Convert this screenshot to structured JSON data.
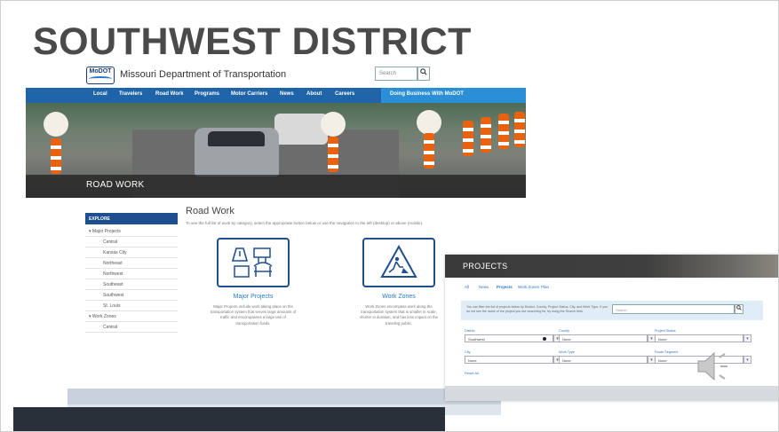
{
  "slide": {
    "title": "SOUTHWEST DISTRICT"
  },
  "modot": {
    "logo_text": "MoDOT",
    "org_name": "Missouri Department of Transportation",
    "search_placeholder": "Search",
    "search_icon": "magnifier-icon",
    "nav": [
      "Local",
      "Travelers",
      "Road Work",
      "Programs",
      "Motor Carriers",
      "News",
      "About",
      "Careers"
    ],
    "nav_cta": "Doing Business With MoDOT",
    "hero_label": "ROAD WORK",
    "sidebar": {
      "header": "EXPLORE",
      "items": [
        {
          "label": "Major Projects",
          "expanded": true
        },
        {
          "label": "Central"
        },
        {
          "label": "Kansas City"
        },
        {
          "label": "Northeast"
        },
        {
          "label": "Northwest"
        },
        {
          "label": "Southeast"
        },
        {
          "label": "Southwest"
        },
        {
          "label": "St. Louis"
        },
        {
          "label": "Work Zones",
          "expanded": true
        },
        {
          "label": "Central"
        }
      ]
    },
    "content": {
      "title": "Road Work",
      "intro": "To see the full list of work by category, select the appropriate button below or use the navigation to the left (desktop) or above (mobile).",
      "cards": [
        {
          "title": "Major Projects",
          "icon": "construction-icons",
          "desc": "Major Projects include work taking place on the transportation system that serves large amounts of traffic and encompasses a large use of transportation funds."
        },
        {
          "title": "Work Zones",
          "icon": "road-worker-sign-icon",
          "desc": "Work Zones encompass work along the transportation system that is smaller in scale, shorter in duration, and has less impact on the traveling public."
        }
      ]
    }
  },
  "projects": {
    "title": "PROJECTS",
    "tabs": [
      "All",
      "News",
      "Projects",
      "Work Zones",
      "Plan"
    ],
    "active_tab": 2,
    "filter_text": "You can filter the list of projects below by District, County, Project Status, City, and Work Type. If you do not see the name of the project you are searching for, try using the Search field.",
    "search_placeholder": "Search",
    "fields": [
      {
        "label": "District",
        "value": "Southwest"
      },
      {
        "label": "County",
        "value": "None"
      },
      {
        "label": "Project Status",
        "value": "None"
      },
      {
        "label": "City",
        "value": "None"
      },
      {
        "label": "Work Type",
        "value": "None"
      },
      {
        "label": "Route Segment",
        "value": "None"
      }
    ],
    "reset_label": "Reset All"
  },
  "colors": {
    "title": "#4a4a4a",
    "nav_blue": "#1f63a8",
    "cta_blue": "#2a8fd6",
    "card_border": "#1f4f8f",
    "link_blue": "#2a78c8"
  }
}
